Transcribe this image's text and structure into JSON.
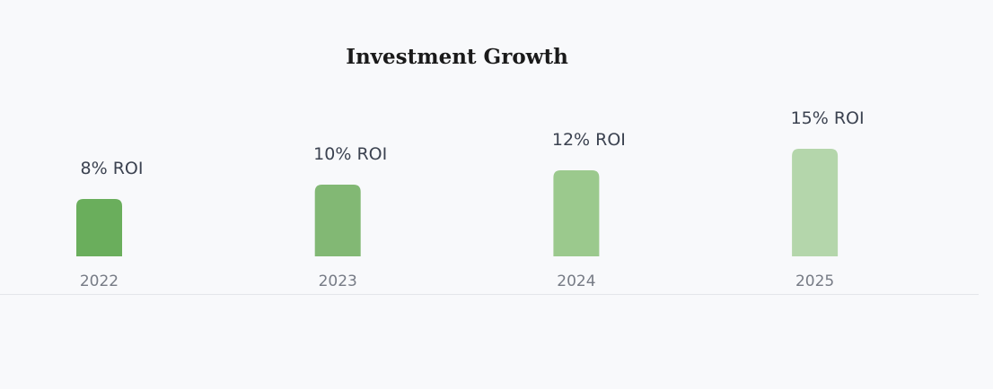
{
  "chart_data": {
    "type": "bar",
    "title": "Investment Growth",
    "categories": [
      "2022",
      "2023",
      "2024",
      "2025"
    ],
    "values": [
      8,
      10,
      12,
      15
    ],
    "data_labels": [
      "8% ROI",
      "10% ROI",
      "12% ROI",
      "15% ROI"
    ],
    "bar_colors": [
      "#6aae5c",
      "#82b874",
      "#9bc98d",
      "#b4d6ab"
    ],
    "ylim": [
      0,
      15
    ],
    "grid": false,
    "legend": "none",
    "xlabel": "",
    "ylabel": ""
  }
}
